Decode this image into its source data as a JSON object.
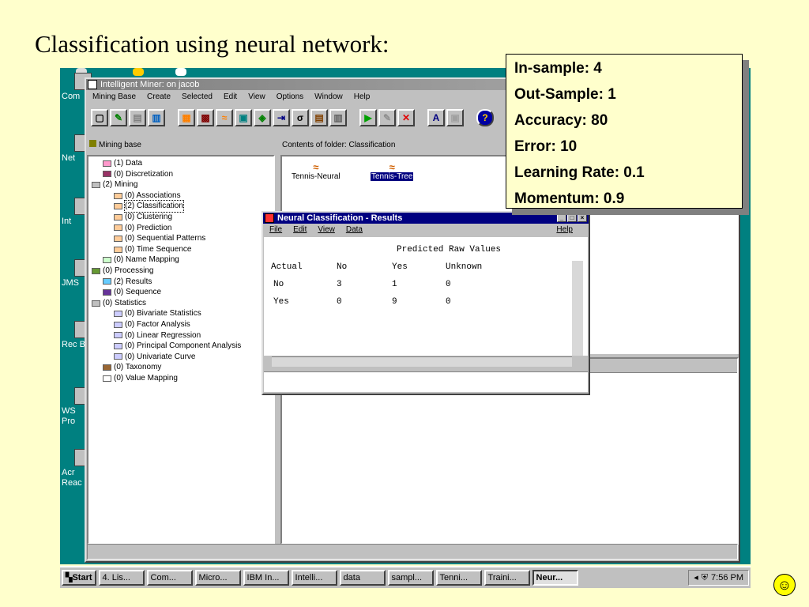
{
  "slide": {
    "title": "Classification using neural network:"
  },
  "desktop": {
    "icons": [
      "Com",
      "Net",
      "Int",
      "JMS",
      "Rec B",
      "WS Pro",
      "Acr Reac"
    ]
  },
  "main_window": {
    "title": "Intelligent Miner:  on jacob",
    "menu": [
      "Mining Base",
      "Create",
      "Selected",
      "Edit",
      "View",
      "Options",
      "Window",
      "Help"
    ],
    "left_header": "Mining base",
    "right_header": "Contents of folder: Classification",
    "tree": [
      {
        "label": "(1) Data",
        "indent": 1,
        "color": "#ff99cc"
      },
      {
        "label": "(0) Discretization",
        "indent": 1,
        "color": "#993366"
      },
      {
        "label": "(2) Mining",
        "indent": 0,
        "color": "#c0c0c0"
      },
      {
        "label": "(0) Associations",
        "indent": 2,
        "color": "#ffcc99"
      },
      {
        "label": "(2) Classification",
        "indent": 2,
        "color": "#ffcc99",
        "selected": true
      },
      {
        "label": "(0) Clustering",
        "indent": 2,
        "color": "#ffcc99"
      },
      {
        "label": "(0) Prediction",
        "indent": 2,
        "color": "#ffcc99"
      },
      {
        "label": "(0) Sequential Patterns",
        "indent": 2,
        "color": "#ffcc99"
      },
      {
        "label": "(0) Time Sequence",
        "indent": 2,
        "color": "#ffcc99"
      },
      {
        "label": "(0) Name Mapping",
        "indent": 1,
        "color": "#ccffcc"
      },
      {
        "label": "(0) Processing",
        "indent": 0,
        "color": "#669933"
      },
      {
        "label": "(2) Results",
        "indent": 1,
        "color": "#66ccff"
      },
      {
        "label": "(0) Sequence",
        "indent": 1,
        "color": "#663399"
      },
      {
        "label": "(0) Statistics",
        "indent": 0,
        "color": "#c0c0c0"
      },
      {
        "label": "(0) Bivariate Statistics",
        "indent": 2,
        "color": "#ccccff"
      },
      {
        "label": "(0) Factor Analysis",
        "indent": 2,
        "color": "#ccccff"
      },
      {
        "label": "(0) Linear Regression",
        "indent": 2,
        "color": "#ccccff"
      },
      {
        "label": "(0) Principal Component Analysis",
        "indent": 2,
        "color": "#ccccff"
      },
      {
        "label": "(0) Univariate Curve",
        "indent": 2,
        "color": "#ccccff"
      },
      {
        "label": "(0) Taxonomy",
        "indent": 1,
        "color": "#996633"
      },
      {
        "label": "(0) Value Mapping",
        "indent": 1,
        "color": "#ffffff"
      }
    ],
    "files": [
      "Tennis-Neural",
      "Tennis-Tree"
    ]
  },
  "results": {
    "title": "Neural Classification - Results",
    "menu": [
      "File",
      "Edit",
      "View",
      "Data"
    ],
    "help": "Help",
    "header": "Predicted Raw Values",
    "columns": [
      "Actual",
      "No",
      "Yes",
      "Unknown"
    ],
    "rows": [
      [
        "No",
        "3",
        "1",
        "0"
      ],
      [
        "Yes",
        "0",
        "9",
        "0"
      ]
    ]
  },
  "callout": [
    "In-sample: 4",
    "Out-Sample: 1",
    "Accuracy: 80",
    "Error: 10",
    "Learning Rate: 0.1",
    "Momentum: 0.9"
  ],
  "taskbar": {
    "start": "Start",
    "tasks": [
      "4. Lis...",
      "Com...",
      "Micro...",
      "IBM In...",
      "Intelli...",
      "data",
      "sampl...",
      "Tenni...",
      "Traini...",
      "Neur..."
    ],
    "active_index": 9,
    "clock": "7:56 PM"
  }
}
